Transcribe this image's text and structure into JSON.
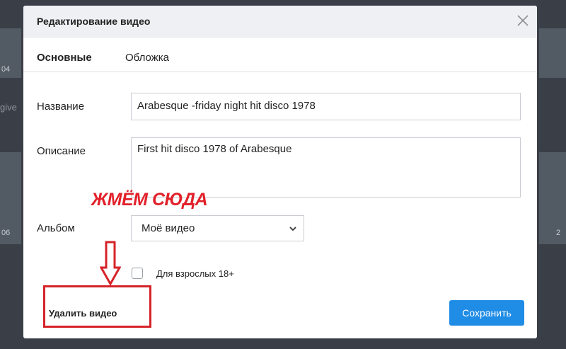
{
  "background": {
    "left_numbers": [
      "04",
      "06"
    ],
    "left_text": "give",
    "right_number": "2"
  },
  "modal": {
    "title": "Редактирование видео",
    "tabs": [
      {
        "label": "Основные",
        "active": true
      },
      {
        "label": "Обложка",
        "active": false
      }
    ],
    "fields": {
      "name_label": "Название",
      "name_value": "Arabesque -friday night hit disco 1978",
      "description_label": "Описание",
      "description_value": "First hit disco 1978 of Arabesque",
      "album_label": "Альбом",
      "album_value": "Моё видео",
      "adult_label": "Для взрослых 18+"
    },
    "delete_label": "Удалить видео",
    "save_label": "Сохранить"
  },
  "annotation": {
    "text": "ЖМЁМ СЮДА",
    "color": "#e2212a"
  },
  "colors": {
    "accent": "#1f8ce6",
    "annotation_red": "#d52329"
  },
  "icons": {
    "close": "close-icon",
    "dropdown": "chevron-down-icon",
    "arrow": "arrow-down-icon"
  }
}
